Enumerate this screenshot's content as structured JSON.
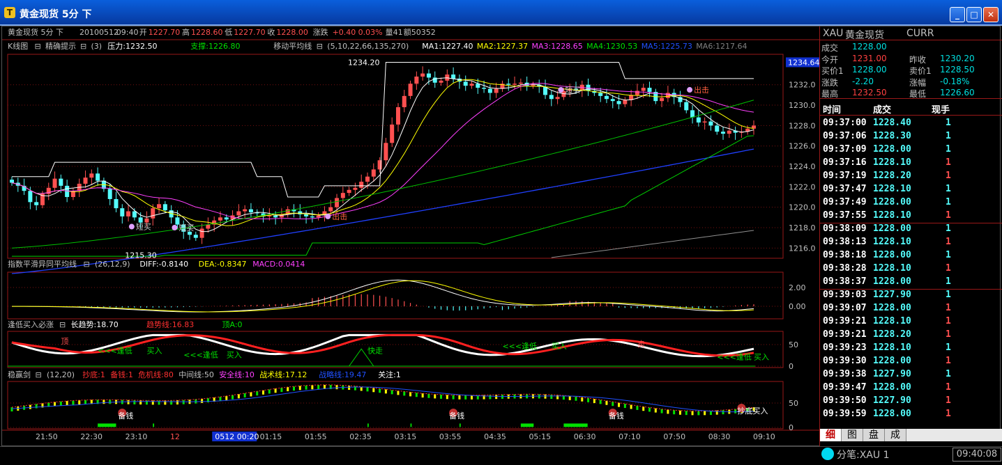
{
  "window": {
    "title": "黄金现货  5分  下",
    "icon": "T"
  },
  "chart_data": [
    {
      "type": "candlestick",
      "name_label": "黄金现货 5分 下",
      "header": {
        "date": "20100512",
        "time": "09:40",
        "open_label": "开",
        "open": "1227.70",
        "high_label": "高",
        "high": "1228.60",
        "low_label": "低",
        "low": "1227.70",
        "close_label": "收",
        "close": "1228.00",
        "change_label": "涨跌",
        "change": "+0.40",
        "change_pct": "0.03%",
        "volume_label": "量",
        "volume": "41",
        "amount_label": "额",
        "amount": "50352"
      },
      "panel_label": "K线图",
      "indicator_title": "精确提示",
      "indicator_params": "(3)",
      "pressure": "压力:1232.50",
      "support": "支撑:1226.80",
      "ma_title": "移动平均线",
      "ma_params": "(5,10,22,66,135,270)",
      "ma_values": [
        "MA1:1227.40",
        "MA2:1227.37",
        "MA3:1228.65",
        "MA4:1230.53",
        "MA5:1225.73",
        "MA6:1217.64"
      ],
      "y_ticks": [
        "1232.0",
        "1230.0",
        "1228.0",
        "1226.0",
        "1224.0",
        "1222.0",
        "1220.0",
        "1218.0",
        "1216.0"
      ],
      "ylim": [
        1215.0,
        1234.64
      ],
      "current_price_tag": "1234.64",
      "high_marker": "1234.20",
      "low_marker": "1215.30",
      "annotations": [
        "短买",
        "短买",
        "出击",
        "短买",
        "出击"
      ],
      "close": [
        1222.4,
        1222.1,
        1221.6,
        1220.5,
        1220.2,
        1221.3,
        1221.9,
        1222.8,
        1222.1,
        1221.0,
        1221.6,
        1222.3,
        1222.9,
        1223.3,
        1222.6,
        1221.8,
        1220.8,
        1219.9,
        1219.1,
        1219.6,
        1219.0,
        1218.5,
        1218.9,
        1219.9,
        1220.3,
        1219.7,
        1219.0,
        1218.3,
        1217.6,
        1217.3,
        1217.0,
        1217.9,
        1218.3,
        1218.7,
        1219.0,
        1218.8,
        1219.2,
        1219.6,
        1219.8,
        1219.5,
        1219.4,
        1219.1,
        1219.2,
        1219.0,
        1219.3,
        1219.8,
        1219.6,
        1219.3,
        1219.1,
        1219.0,
        1219.2,
        1219.6,
        1220.0,
        1220.9,
        1221.4,
        1221.7,
        1221.9,
        1222.5,
        1223.0,
        1223.7,
        1224.6,
        1226.3,
        1228.1,
        1229.8,
        1230.9,
        1232.1,
        1232.8,
        1233.1,
        1232.7,
        1232.2,
        1232.4,
        1233.0,
        1232.6,
        1232.3,
        1231.9,
        1232.1,
        1231.7,
        1231.6,
        1231.2,
        1231.6,
        1232.1,
        1232.0,
        1232.1,
        1232.2,
        1231.9,
        1232.0,
        1231.8,
        1231.0,
        1230.6,
        1230.8,
        1231.4,
        1231.6,
        1231.5,
        1232.0,
        1231.4,
        1231.2,
        1230.9,
        1230.6,
        1230.4,
        1230.1,
        1230.5,
        1231.0,
        1231.4,
        1231.7,
        1231.3,
        1230.4,
        1230.7,
        1231.2,
        1230.8,
        1230.3,
        1229.5,
        1228.8,
        1228.3,
        1228.4,
        1228.0,
        1227.4,
        1227.2,
        1227.5,
        1227.3,
        1227.4,
        1227.7,
        1228.0
      ]
    },
    {
      "type": "line",
      "panel_label": "指数平滑异同平均线",
      "params": "(26,12,9)",
      "diff": "DIFF:-0.8140",
      "dea": "DEA:-0.8347",
      "macd": "MACD:0.0414",
      "y_ticks": [
        "2.00",
        "0.00"
      ]
    },
    {
      "type": "line",
      "panel_label": "逢低买入必涨",
      "long_trend": "长趋势:18.70",
      "trend_line": "趋势线:16.83",
      "top": "顶A:0",
      "y_ticks": [
        "50",
        "0"
      ],
      "annotations": [
        "顶",
        "<<<逢低",
        "买入",
        "<<<逢低",
        "买入",
        "快走",
        "<<<逢低",
        "买入",
        "卖",
        "<<<逢低",
        "买入"
      ]
    },
    {
      "type": "line",
      "panel_label": "稳赢剑",
      "params": "(12,20)",
      "values": [
        "抄底:1",
        "备钱:1",
        "危机线:80",
        "中间线:50",
        "安全线:10",
        "战术线:17.12",
        "战略线:19.47",
        "关注:1"
      ],
      "y_ticks": [
        "50",
        "0"
      ],
      "annotations": [
        "备钱",
        "备钱",
        "备钱",
        "抄底买入"
      ]
    }
  ],
  "x_axis": {
    "ticks": [
      "21:50",
      "22:30",
      "23:10",
      "12",
      "0512 00:20",
      "01:15",
      "01:55",
      "02:35",
      "03:15",
      "03:55",
      "04:35",
      "05:15",
      "06:30",
      "07:10",
      "07:50",
      "08:30",
      "09:10"
    ]
  },
  "quote": {
    "symbol": "XAU",
    "name": "黄金现货",
    "currency": "CURR",
    "rows": [
      {
        "l1": "成交",
        "v1": "1228.00",
        "l2": "",
        "v2": ""
      },
      {
        "l1": "今开",
        "v1": "1231.00",
        "l2": "昨收",
        "v2": "1230.20"
      },
      {
        "l1": "买价1",
        "v1": "1228.00",
        "l2": "卖价1",
        "v2": "1228.50"
      },
      {
        "l1": "涨跌",
        "v1": "-2.20",
        "l2": "涨幅",
        "v2": "-0.18%"
      },
      {
        "l1": "最高",
        "v1": "1232.50",
        "l2": "最低",
        "v2": "1226.60"
      }
    ]
  },
  "ticks": {
    "headers": [
      "时间",
      "成交",
      "现手"
    ],
    "rows": [
      [
        "09:37:00",
        "1228.40",
        "1"
      ],
      [
        "09:37:06",
        "1228.30",
        "1"
      ],
      [
        "09:37:09",
        "1228.00",
        "1"
      ],
      [
        "09:37:16",
        "1228.10",
        "1"
      ],
      [
        "09:37:19",
        "1228.20",
        "1"
      ],
      [
        "09:37:47",
        "1228.10",
        "1"
      ],
      [
        "09:37:49",
        "1228.00",
        "1"
      ],
      [
        "09:37:55",
        "1228.10",
        "1"
      ],
      [
        "09:38:09",
        "1228.00",
        "1"
      ],
      [
        "09:38:13",
        "1228.10",
        "1"
      ],
      [
        "09:38:18",
        "1228.00",
        "1"
      ],
      [
        "09:38:28",
        "1228.10",
        "1"
      ],
      [
        "09:38:37",
        "1228.00",
        "1"
      ],
      [
        "09:39:03",
        "1227.90",
        "1"
      ],
      [
        "09:39:07",
        "1228.00",
        "1"
      ],
      [
        "09:39:21",
        "1228.10",
        "1"
      ],
      [
        "09:39:21",
        "1228.20",
        "1"
      ],
      [
        "09:39:23",
        "1228.10",
        "1"
      ],
      [
        "09:39:30",
        "1228.00",
        "1"
      ],
      [
        "09:39:38",
        "1227.90",
        "1"
      ],
      [
        "09:39:47",
        "1228.00",
        "1"
      ],
      [
        "09:39:50",
        "1227.90",
        "1"
      ],
      [
        "09:39:59",
        "1228.00",
        "1"
      ]
    ],
    "qty_colors": [
      "cyan",
      "cyan",
      "cyan",
      "red",
      "red",
      "cyan",
      "cyan",
      "red",
      "cyan",
      "red",
      "cyan",
      "red",
      "cyan",
      "cyan",
      "red",
      "red",
      "red",
      "cyan",
      "red",
      "cyan",
      "red",
      "red",
      "red"
    ]
  },
  "tabs": [
    "细",
    "图",
    "盘",
    "成"
  ],
  "status": {
    "text": "分笔:XAU 1",
    "time": "09:40:08"
  },
  "colors": {
    "up": "#ff5050",
    "down": "#54fcfc",
    "border": "#9a1818"
  }
}
